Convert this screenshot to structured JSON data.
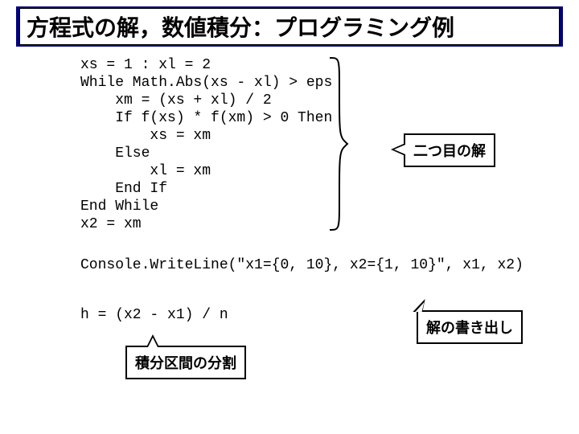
{
  "title": "方程式の解，数値積分：プログラミング例",
  "code": "xs = 1 : xl = 2\nWhile Math.Abs(xs - xl) > eps\n    xm = (xs + xl) / 2\n    If f(xs) * f(xm) > 0 Then\n        xs = xm\n    Else\n        xl = xm\n    End If\nEnd While\nx2 = xm",
  "console_line": "Console.WriteLine(\"x1={0, 10}, x2={1, 10}\", x1, x2)",
  "h_line": "h = (x2 - x1) / n",
  "callout_second_root": "二つ目の解",
  "callout_output": "解の書き出し",
  "callout_divide": "積分区間の分割"
}
